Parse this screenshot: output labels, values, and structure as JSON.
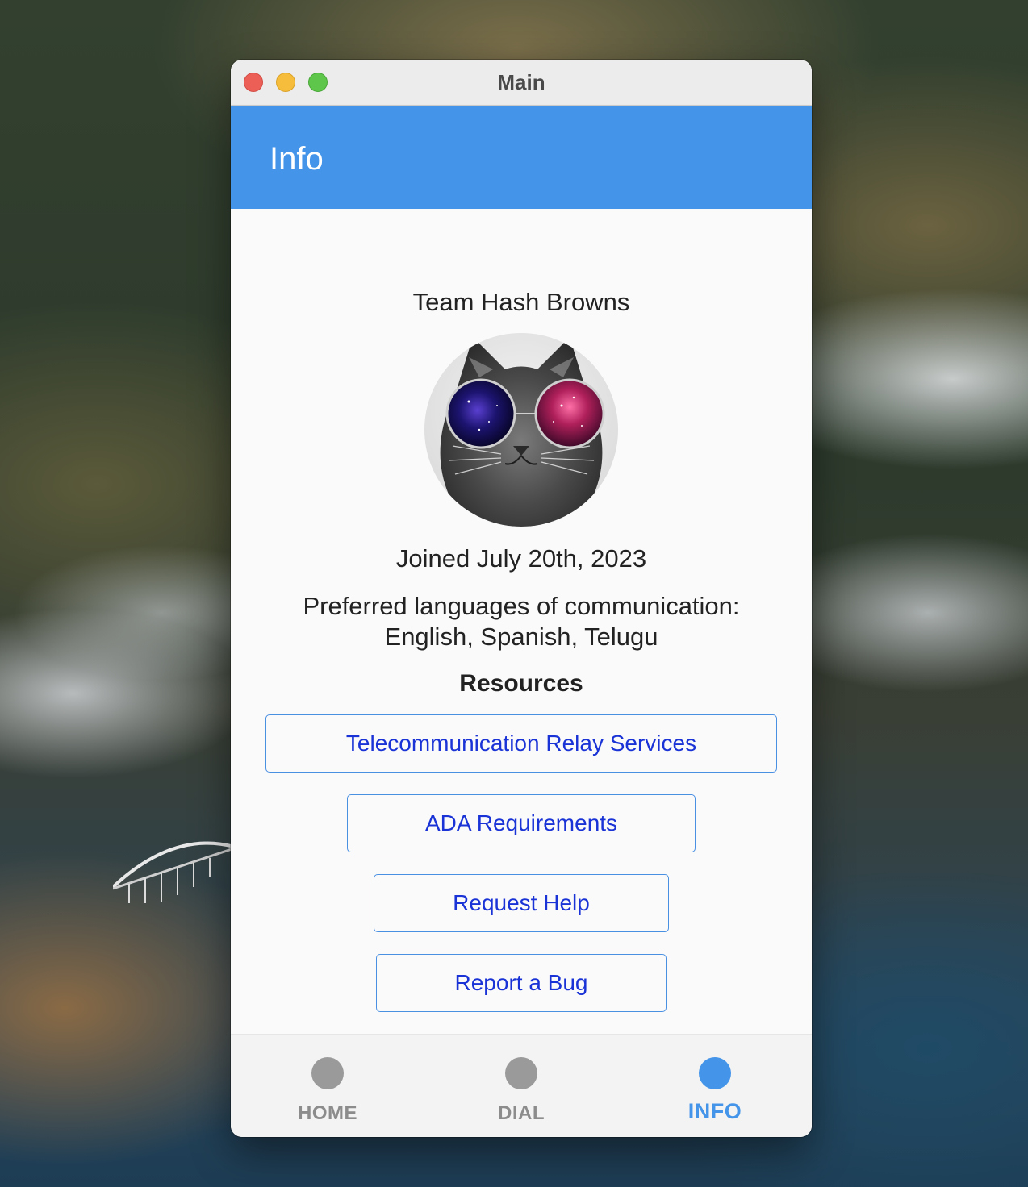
{
  "window": {
    "title": "Main"
  },
  "appbar": {
    "title": "Info"
  },
  "profile": {
    "team_name": "Team Hash Browns",
    "joined": "Joined July 20th, 2023",
    "languages_line1": "Preferred languages of communication:",
    "languages_line2": "English, Spanish, Telugu"
  },
  "resources": {
    "heading": "Resources",
    "buttons": [
      {
        "label": "Telecommunication Relay Services"
      },
      {
        "label": "ADA Requirements"
      },
      {
        "label": "Request Help"
      },
      {
        "label": "Report a Bug"
      }
    ]
  },
  "bottom_nav": {
    "items": [
      {
        "label": "HOME",
        "active": false
      },
      {
        "label": "DIAL",
        "active": false
      },
      {
        "label": "INFO",
        "active": true
      }
    ]
  },
  "colors": {
    "accent": "#4495ea",
    "link_text": "#1a33d6",
    "inactive_nav": "#8c8c8c",
    "close": "#ec5f57",
    "minimize": "#f5bd3b",
    "maximize": "#5ec64a"
  }
}
